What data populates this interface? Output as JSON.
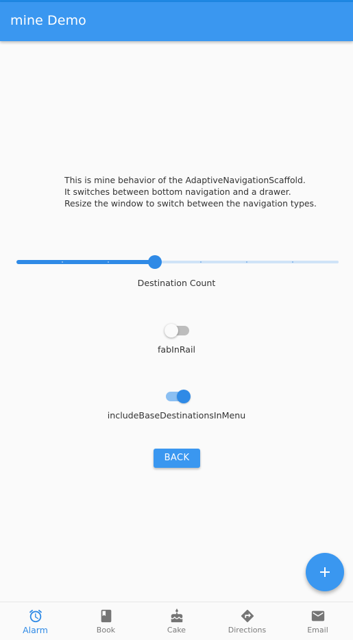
{
  "app_bar": {
    "title": "mine Demo",
    "color": "#3a97f0"
  },
  "description": {
    "lines": [
      "This is mine behavior of the AdaptiveNavigationScaffold.",
      "It switches between bottom navigation and a drawer.",
      "Resize the window to switch between the navigation types."
    ]
  },
  "destination_slider": {
    "label": "Destination Count",
    "value_fraction": 0.43,
    "divisions": 7,
    "accent_color": "#2f8ae6"
  },
  "switches": {
    "fab_in_rail": {
      "label": "fabInRail",
      "checked": false
    },
    "include_base_destinations": {
      "label": "includeBaseDestinationsInMenu",
      "checked": true
    }
  },
  "back_button": {
    "label": "BACK"
  },
  "fab": {
    "icon": "plus-icon"
  },
  "bottom_nav": {
    "active_index": 0,
    "items": [
      {
        "label": "Alarm",
        "icon": "alarm-icon"
      },
      {
        "label": "Book",
        "icon": "book-icon"
      },
      {
        "label": "Cake",
        "icon": "cake-icon"
      },
      {
        "label": "Directions",
        "icon": "directions-icon"
      },
      {
        "label": "Email",
        "icon": "email-icon"
      }
    ]
  }
}
